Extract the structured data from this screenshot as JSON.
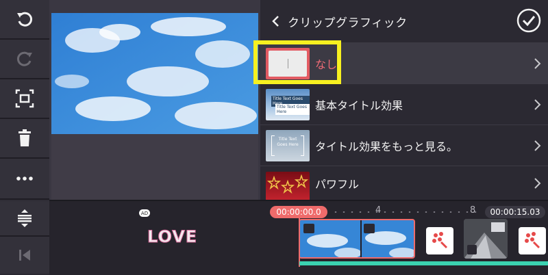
{
  "panel": {
    "title": "クリップグラフィック",
    "items": [
      {
        "label": "なし",
        "selected": true
      },
      {
        "label": "基本タイトル効果"
      },
      {
        "label": "タイトル効果をもっと見る。"
      },
      {
        "label": "パワフル"
      }
    ],
    "thumb_text": {
      "basic_line1": "Title Text Goes Here",
      "basic_line2": "Title Text Goes Here",
      "more_line1": "Title Text",
      "more_line2": "Goes Here"
    }
  },
  "toolbar": {
    "icons": [
      "undo-icon",
      "redo-icon",
      "crop-icon",
      "delete-icon",
      "more-icon"
    ],
    "bottom_icons": [
      "expand-vertical-icon",
      "skip-start-icon"
    ]
  },
  "timeline": {
    "current_time": "00:00:00.0",
    "total_time": "00:00:15.03",
    "ruler_marks": [
      "4",
      "8"
    ],
    "ad_badge": "AD",
    "ad_text": "LOVE"
  },
  "colors": {
    "accent_red": "#ef6b6b",
    "highlight_yellow": "#f7f020",
    "timeline_bar": "#3bd2b1"
  }
}
